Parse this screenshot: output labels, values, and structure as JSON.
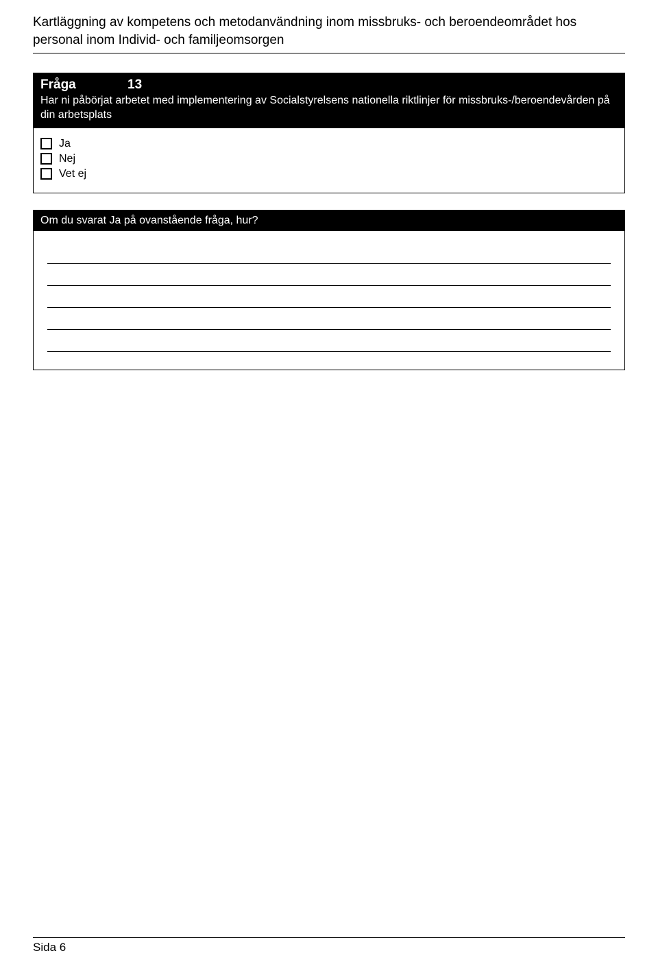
{
  "header": {
    "title_line1": "Kartläggning av kompetens och metodanvändning inom missbruks- och beroendeområdet hos",
    "title_line2": "personal inom Individ- och familjeomsorgen"
  },
  "question": {
    "label": "Fråga",
    "number": "13",
    "text": "Har ni påbörjat arbetet med implementering av Socialstyrelsens nationella riktlinjer för missbruks-/beroendevården på din arbetsplats",
    "options": [
      "Ja",
      "Nej",
      "Vet ej"
    ]
  },
  "followup": {
    "header_text": "Om du svarat Ja på ovanstående fråga, hur?"
  },
  "footer": {
    "page_label": "Sida 6"
  }
}
